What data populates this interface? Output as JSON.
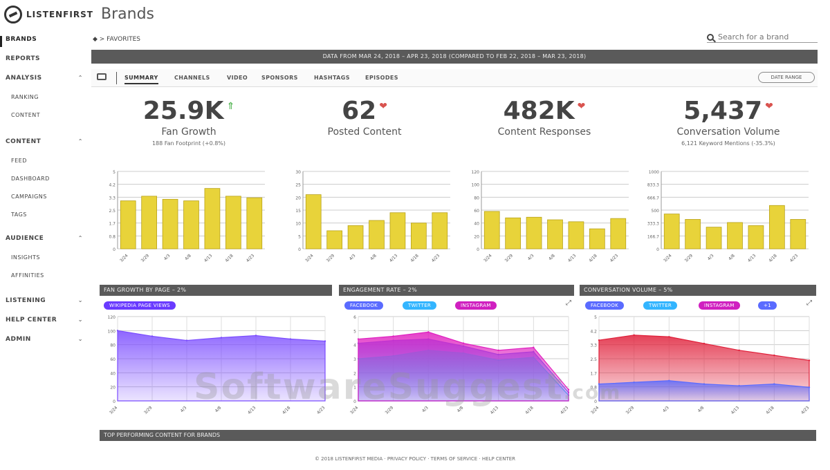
{
  "app": {
    "brand": "LISTENFIRST",
    "title": "Brands"
  },
  "sidebar": {
    "items": [
      {
        "label": "BRANDS",
        "active": true
      },
      {
        "label": "REPORTS"
      },
      {
        "label": "ANALYSIS",
        "caret": "^"
      },
      {
        "label": "RANKING",
        "sub": true
      },
      {
        "label": "CONTENT",
        "sub": true
      },
      {
        "label": "CONTENT",
        "caret": "^"
      },
      {
        "label": "FEED",
        "sub": true
      },
      {
        "label": "DASHBOARD",
        "sub": true
      },
      {
        "label": "CAMPAIGNS",
        "sub": true
      },
      {
        "label": "TAGS",
        "sub": true
      },
      {
        "label": "AUDIENCE",
        "caret": "^"
      },
      {
        "label": "INSIGHTS",
        "sub": true
      },
      {
        "label": "AFFINITIES",
        "sub": true
      },
      {
        "label": "LISTENING",
        "caret": "v"
      },
      {
        "label": "HELP CENTER",
        "caret": "v"
      },
      {
        "label": "ADMIN",
        "caret": "v"
      }
    ]
  },
  "breadcrumb": "◆ > FAVORITES",
  "search": {
    "placeholder": "Search for a brand"
  },
  "date_banner": "DATA FROM MAR 24, 2018 – APR 23, 2018 (COMPARED TO FEB 22, 2018 – MAR 23, 2018)",
  "tabs": {
    "items": [
      "SUMMARY",
      "CHANNELS",
      "VIDEO",
      "SPONSORS",
      "HASHTAGS",
      "EPISODES"
    ],
    "dropdown": "DATE RANGE"
  },
  "kpis": [
    {
      "value": "25.9K",
      "trend": "up",
      "label": "Fan Growth",
      "sub": "188 Fan Footprint (+0.8%)"
    },
    {
      "value": "62",
      "trend": "down",
      "label": "Posted Content",
      "sub": ""
    },
    {
      "value": "482K",
      "trend": "down",
      "label": "Content Responses",
      "sub": ""
    },
    {
      "value": "5,437",
      "trend": "down",
      "label": "Conversation Volume",
      "sub": "6,121 Keyword Mentions (-35.3%)"
    }
  ],
  "panels": {
    "fans": {
      "title": "FAN GROWTH BY PAGE – 2%",
      "pills": [
        "WIKIPEDIA PAGE VIEWS"
      ]
    },
    "engagement": {
      "title": "ENGAGEMENT RATE – 2%",
      "pills": [
        "FACEBOOK",
        "TWITTER",
        "INSTAGRAM"
      ]
    },
    "conversation": {
      "title": "CONVERSATION VOLUME – 5%",
      "pills": [
        "FACEBOOK",
        "TWITTER",
        "INSTAGRAM",
        "+1"
      ]
    }
  },
  "bottom_bar": "TOP PERFORMING CONTENT FOR BRANDS",
  "footer": "© 2018 LISTENFIRST MEDIA · PRIVACY POLICY · TERMS OF SERVICE · HELP CENTER",
  "watermark": {
    "main": "SoftwareSuggest",
    "suffix": ".com"
  },
  "colors": {
    "bar": "#e8d33a",
    "bar_border": "#b8a21a",
    "header": "#5a5a5a"
  },
  "chart_data": [
    {
      "type": "bar",
      "categories": [
        "3/24",
        "3/29",
        "4/3",
        "4/8",
        "4/13",
        "4/18",
        "4/23"
      ],
      "values": [
        3.1,
        3.4,
        3.2,
        3.1,
        3.9,
        3.4,
        3.3
      ],
      "ylim": [
        0,
        5
      ]
    },
    {
      "type": "bar",
      "categories": [
        "3/24",
        "3/29",
        "4/3",
        "4/8",
        "4/13",
        "4/18",
        "4/23"
      ],
      "values": [
        21,
        7,
        9,
        11,
        14,
        10,
        14
      ],
      "ylim": [
        0,
        30
      ]
    },
    {
      "type": "bar",
      "categories": [
        "3/24",
        "3/29",
        "4/3",
        "4/8",
        "4/13",
        "4/18",
        "4/23"
      ],
      "values": [
        58,
        48,
        49,
        45,
        42,
        31,
        47
      ],
      "ylim": [
        0,
        120
      ]
    },
    {
      "type": "bar",
      "categories": [
        "3/24",
        "3/29",
        "4/3",
        "4/8",
        "4/13",
        "4/18",
        "4/23"
      ],
      "values": [
        450,
        380,
        280,
        340,
        300,
        560,
        380
      ],
      "ylim": [
        0,
        1000
      ]
    },
    {
      "type": "area",
      "x": [
        "3/24",
        "3/29",
        "4/3",
        "4/8",
        "4/13",
        "4/18",
        "4/23"
      ],
      "series": [
        {
          "name": "WIKIPEDIA PAGE VIEWS",
          "values": [
            100,
            92,
            86,
            90,
            93,
            88,
            85
          ],
          "color": "#7a4bff"
        }
      ],
      "ylim": [
        0,
        120
      ]
    },
    {
      "type": "area",
      "x": [
        "3/24",
        "3/29",
        "4/3",
        "4/8",
        "4/13",
        "4/18",
        "4/23"
      ],
      "series": [
        {
          "name": "FACEBOOK",
          "values": [
            4.1,
            4.3,
            4.4,
            3.9,
            3.3,
            3.5,
            0.6
          ],
          "color": "#5a6bff"
        },
        {
          "name": "TWITTER",
          "values": [
            3.0,
            3.2,
            3.6,
            3.4,
            2.9,
            3.1,
            0.4
          ],
          "color": "#33b5ff"
        },
        {
          "name": "INSTAGRAM",
          "values": [
            4.4,
            4.6,
            4.9,
            4.1,
            3.6,
            3.8,
            0.8
          ],
          "color": "#e020c0"
        }
      ],
      "ylim": [
        0,
        6
      ]
    },
    {
      "type": "area",
      "x": [
        "3/24",
        "3/29",
        "4/3",
        "4/8",
        "4/13",
        "4/18",
        "4/23"
      ],
      "series": [
        {
          "name": "FACEBOOK",
          "values": [
            3.6,
            3.9,
            3.8,
            3.4,
            3.0,
            2.7,
            2.4
          ],
          "color": "#e0203a"
        },
        {
          "name": "TWITTER",
          "values": [
            1.0,
            1.1,
            1.2,
            1.0,
            0.9,
            1.0,
            0.8
          ],
          "color": "#5a6bff"
        }
      ],
      "ylim": [
        0,
        5
      ]
    }
  ]
}
